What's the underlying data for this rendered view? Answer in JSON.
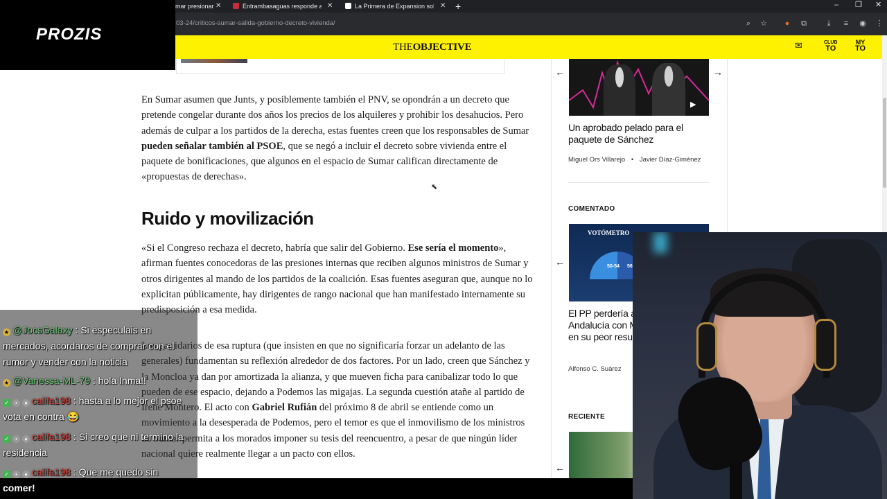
{
  "browser": {
    "tabs": [
      {
        "label": "mar presionar",
        "color": "#f3a33a"
      },
      {
        "label": "Entrambasaguas responde a la",
        "color": "#c92a3a"
      },
      {
        "label": "La Primera de Expansion sobre",
        "color": "#ffffff"
      }
    ],
    "new_tab": "+",
    "url": "03-24/criticos-sumar-salida-gobierno-decreto-vivienda/",
    "window_controls": [
      "–",
      "❐",
      "✕"
    ]
  },
  "site": {
    "logo_light": "THE",
    "logo_bold": "OBJECTIVE",
    "club": [
      "CLUB",
      "TO"
    ],
    "my": [
      "MY",
      "TO"
    ],
    "accent": "#fff200"
  },
  "article": {
    "p1_a": "En Sumar asumen que Junts, y posiblemente también el PNV, se opondrán a un decreto que pretende congelar durante dos años los precios de los alquileres y prohibir los desahucios. Pero además de culpar a los partidos de la derecha, estas fuentes creen que los responsables de Sumar ",
    "p1_b": "pueden señalar también al PSOE",
    "p1_c": ", que se negó a incluir el decreto sobre vivienda entre el paquete de bonificaciones, que algunos en el espacio de Sumar califican directamente de «propuestas de derechas».",
    "heading": "Ruido y movilización",
    "p2_a": "«Si el Congreso rechaza el decreto, habría que salir del Gobierno. ",
    "p2_b": "Ese sería el momento",
    "p2_c": "», afirman fuentes conocedoras de las presiones internas que reciben algunos ministros de Sumar y otros dirigentes al mando de los partidos de la coalición. Esas fuentes aseguran que, aunque no lo explicitan públicamente, hay dirigentes de rango nacional que han manifestado internamente su predisposición a esa medida.",
    "p3_a": "Los partidarios de esa ruptura (que insisten en que no significaría forzar un adelanto de las generales) fundamentan su reflexión alrededor de dos factores. Por un lado, creen que Sánchez y la Moncloa ya dan por amortizada la alianza, y que mueven ficha para canibalizar todo lo que pueden de ese espacio, dejando a Podemos las migajas. La segunda cuestión atañe al partido de Irene Montero. El acto con ",
    "p3_b": "Gabriel Rufián",
    "p3_c": " del próximo 8 de abril se entiende como un movimiento a la desesperada de Podemos, pero el temor es que el inmovilismo de los ministros de Sumar permita a los morados imponer su tesis del reencuentro, a pesar de que ningún líder nacional quiere realmente llegar a un pacto con ellos."
  },
  "sidebar": {
    "card1_title": "Un aprobado pelado para el paquete de Sánchez",
    "card1_author1": "Miguel Ors Villarejo",
    "card1_author2": "Javier Díaz-Giménez",
    "section_commented": "COMENTADO",
    "votometro": "VOTÓMETRO",
    "vnum1": "50-54",
    "vnum2": "56",
    "card2_title": "El PP perdería absoluta en Andalucía con Montero hundida en su peor resultado",
    "card2_author": "Alfonso C. Suárez",
    "section_recent": "RECIENTE",
    "arrow_left": "←",
    "arrow_right": "→",
    "play": "▶"
  },
  "overlay": {
    "brand": "PROZIS",
    "chat": [
      {
        "user": "@JocsGalaxy",
        "text": "Si especulais en mercados, acordaros de comprar con el rumor y vender con la noticia",
        "color": "green"
      },
      {
        "user": "@Vanessa-ML-79",
        "text": "hola Inma!!",
        "color": "green"
      },
      {
        "user": "califa198",
        "text": "hasta a lo mejor el psoe vota en contra 😂",
        "color": "red"
      },
      {
        "user": "califa198",
        "text": "Si creo que ni termino la residencia",
        "color": "red"
      },
      {
        "user": "califa198",
        "text": "Que me quedo sin",
        "color": "red"
      }
    ],
    "bottom_text": "comer!"
  }
}
